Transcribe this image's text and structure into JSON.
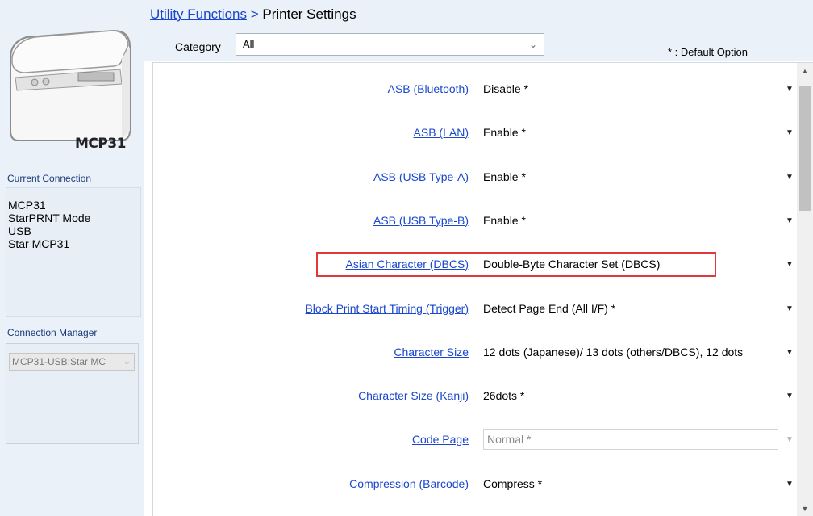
{
  "sidebar": {
    "printer_model": "MCP31",
    "current_connection_heading": "Current Connection",
    "connection_lines": [
      "MCP31",
      "StarPRNT Mode",
      "USB",
      "Star MCP31"
    ],
    "connection_manager_heading": "Connection Manager",
    "connection_manager_value": "MCP31-USB:Star MC"
  },
  "breadcrumb": {
    "parent": "Utility Functions",
    "separator": " > ",
    "current": "Printer Settings"
  },
  "category": {
    "label": "Category",
    "value": "All"
  },
  "default_note": "* : Default Option",
  "settings": [
    {
      "label": "ASB (Bluetooth)",
      "value": "Disable *",
      "enabled": true
    },
    {
      "label": "ASB (LAN)",
      "value": "Enable *",
      "enabled": true
    },
    {
      "label": "ASB (USB Type-A)",
      "value": "Enable *",
      "enabled": true
    },
    {
      "label": "ASB (USB Type-B)",
      "value": "Enable *",
      "enabled": true
    },
    {
      "label": "Asian Character (DBCS)",
      "value": "Double-Byte Character Set (DBCS)",
      "enabled": true,
      "highlighted": true
    },
    {
      "label": "Block Print Start Timing (Trigger)",
      "value": "Detect Page End (All I/F) *",
      "enabled": true
    },
    {
      "label": "Character Size",
      "value": "12 dots (Japanese)/ 13 dots (others/DBCS), 12 dots",
      "enabled": true
    },
    {
      "label": "Character Size (Kanji)",
      "value": "26dots *",
      "enabled": true
    },
    {
      "label": "Code Page",
      "value": "Normal *",
      "enabled": false
    },
    {
      "label": "Compression (Barcode)",
      "value": "Compress *",
      "enabled": true
    }
  ],
  "colors": {
    "link": "#1a47cc",
    "highlight": "#e0393c",
    "sidebar_bg": "#eaf1f8"
  }
}
